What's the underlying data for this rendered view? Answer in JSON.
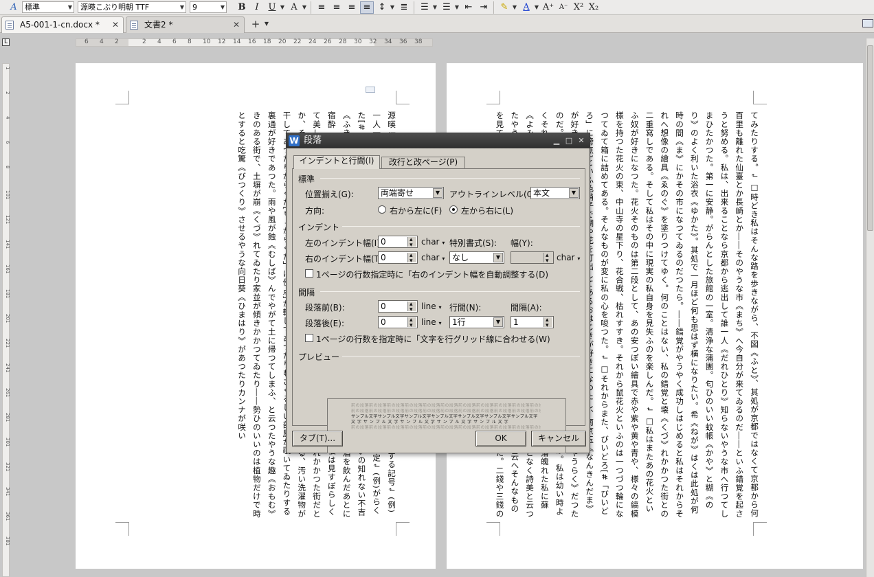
{
  "toolbar": {
    "style": "標準",
    "font": "源暎こぶり明朝 TTF",
    "size": "9"
  },
  "tabs": [
    {
      "label": "A5-001-1-cn.docx *"
    },
    {
      "label": "文書2 *"
    }
  ],
  "ruler": {
    "h_ticks": [
      "6",
      "4",
      "2",
      "2",
      "4",
      "6",
      "8",
      "10",
      "12",
      "14",
      "16",
      "18",
      "20",
      "22",
      "24",
      "26",
      "28",
      "30",
      "32",
      "34",
      "36",
      "38"
    ],
    "v_ticks": [
      "1",
      "2",
      "4",
      "6",
      "8",
      "101",
      "121",
      "141",
      "161",
      "181",
      "201",
      "221",
      "241",
      "261",
      "281",
      "301",
      "321",
      "341",
      "361",
      "381"
    ]
  },
  "pages": {
    "left_text": "源暎 標棟 梶井基 【テキ ◎: (例)不吉《ふきつ》↲ |:ルビの付く文字列の始まりを特定する記号↲ (例)一人一取残《とりのこ》された。↲ [#]:入力者注□主に外字の説明や、傍点の位置の指定↲ (例)がらくた[#「がらくた」に傍点]↲ -------------------------------------------------------↲ □えたいの知れない不吉《ふきつ》な塊が私の心を始終圧へつけてゐた。焦燥と云はうか、嫌悪と云はうか――酒を飲んだあとに宿酔《ふつかよひ》があるやうに、酒を毎日 を浮浪し続けてゐた。↲ □何故だか其頃私は見すぼらしくて美しいものに強くひきつけられたのを覚《おぼ》えてゐる。風景にしても壊《くづ》れかかつた街だとか、その街にしても他所他所《よそよそ》しい表通りよりもどこか親《した》しみのある、汚い洗濯物が干してあつたりがらくた[#「がらくた」に傍点]が転してあつたりむさくるしい部屋が覗いてゐたりする裏通が好きであつた。雨や風が蝕《むしば》んでやがて土に帰つてしまふ、と云つたやうな趣《おもむ》きのある街で、土塀が崩《くづ》れてゐたり家並が傾きかかつてゐたり――勢ひのいいのは植物だけで時とすると吃驚《びつくり》させるやうな向日葵《ひまはり》があつたりカンナが咲い",
    "right_text": "てみたりする。↲ □時どき私はそんな路を歩きながら、不図《ふと》、其処が京都ではなくて京都から何百里も離れた仙臺とか長崎とか――そのやうな市《まち》へ今自分が来てゐるのだ――といふ錯覚を起さうと努める。私は、出来ることなら京都から逃出して誰一人《だれひとり》知らないやうな市へ行つてしまひたかつた。第一に安静。がらんとした旅館の一室。清浄な蒲團。匂ひのいい蚊帳《かや》と糊《のり》のよく利いた浴衣《ゆかた》。其処で一月ほど何も思はず横になりたい。希《ねが》はくは此処が何時の間《ま》にかその市になつてゐるのだつたら。――錯覚がやうやく成功しはじめると私はそれからそれへ想像の繪具《ゑのぐ》を塗りつけてゆく。何のことはない、私の錯覚と壊《くづ》れかかつた街との二重寫しである。そして私はその中に現実の私自身を見失ふのを楽しんだ。↲ □私はまたあの花火といふ奴が好きになつた。花火そのものは第二段として、あの安つぽい繪具で赤や紫や黄や青や、様々の縞模様を持つた花火の束、中山寺の星下り、花合戦、枯れすすき。それから鼠花火といふのは一つづつ輪になつてゐて箱に詰めてある。そんなものが変に私の心を唆つた。↲ □それからまた、びいどろ[#「びいどろ」に傍点]といふ色硝子で鯛や花を打出してあるおはじきが好きになつたし、南京玉《なんきんだま》が好きになつた。またそれを嘗《な》めて見るのが私にとつて何ともいへない享樂《きやうらく》だつたのだ。あのびいどろ[#「びいどろ」に傍点]の味程幽《かす》かな涼しい味があるものか。私は幼い時よくそれを口に入れては父母に叱られたものだが、その幼時のあまい記憶が大きくなつて落魄れた私に蘇《よみがへ》つて来る故《せゐ》だらうか、全くあの味には幽かな爽《さはや》かな何となく詩美と云つたやうな味覚が漂つて来る。↲ □察しはつくだらうが私にはまるで金がなかつた。とは云へそんなものを見て少しでも心の動きかけた時の私自身を慰める為には贅沢といふことが必要であつた。二錢や三錢のもの――と云つて贅沢なもの。美しいもの――と云つて無気力な私の触角に寧ろ媚びて来るもの。――さう云つたものが自然私を慰めるのだ。↲ □生活がまだ蝕まれてゐなかつた以前私の好きであつた所は、例へば丸善であつた。赤や黄のオードコロンやオードキユニン。洒落た切子細工《きりこ"
  },
  "dialog": {
    "title": "段落",
    "tabs": [
      "インデントと行間(I)",
      "改行と改ページ(P)"
    ],
    "sections": {
      "standard": "標準",
      "indent": "インデント",
      "spacing": "間隔",
      "preview": "プレビュー"
    },
    "alignment": {
      "label": "位置揃え(G):",
      "value": "両端寄せ"
    },
    "outline": {
      "label": "アウトラインレベル(O)",
      "value": "本文"
    },
    "direction": {
      "label": "方向:",
      "rtl": "右から左に(F)",
      "ltr": "左から右に(L)",
      "selected": "ltr"
    },
    "indent": {
      "left_label": "左のインデント幅(I)",
      "left_value": "0",
      "right_label": "右のインデント幅(T)",
      "right_value": "0",
      "unit": "char",
      "special_label": "特別書式(S):",
      "special_value": "なし",
      "width_label": "幅(Y):",
      "width_value": "",
      "auto_adjust": "1ページの行数指定時に「右のインデント幅を自動調整する(D)"
    },
    "spacing": {
      "before_label": "段落前(B):",
      "before_value": "0",
      "after_label": "段落後(E):",
      "after_value": "0",
      "unit": "line",
      "line_label": "行間(N):",
      "line_value": "1行",
      "at_label": "間隔(A):",
      "at_value": "1",
      "grid_snap": "1ページの行数を指定時に「文字を行グリッド線に合わせる(W)"
    },
    "preview_text": {
      "prev": "前の段落前の段落前の段落前の段落前の段落前の段落前の段落前の段落前の段落前の段落前の段落前の段落前の段落",
      "sample1": "サンプル文字サンプル文字サンプル文字サンプル文字サンプル文字サンプル文字サンプル文字",
      "sample2": "文 字 サ ン プ ル 文 字 サ ン プ ル 文 字 サ ン プ ル 文 字 サ ン プ ル 文 字"
    },
    "buttons": {
      "tabs": "タブ(T)...",
      "ok": "OK",
      "cancel": "キャンセル"
    }
  }
}
